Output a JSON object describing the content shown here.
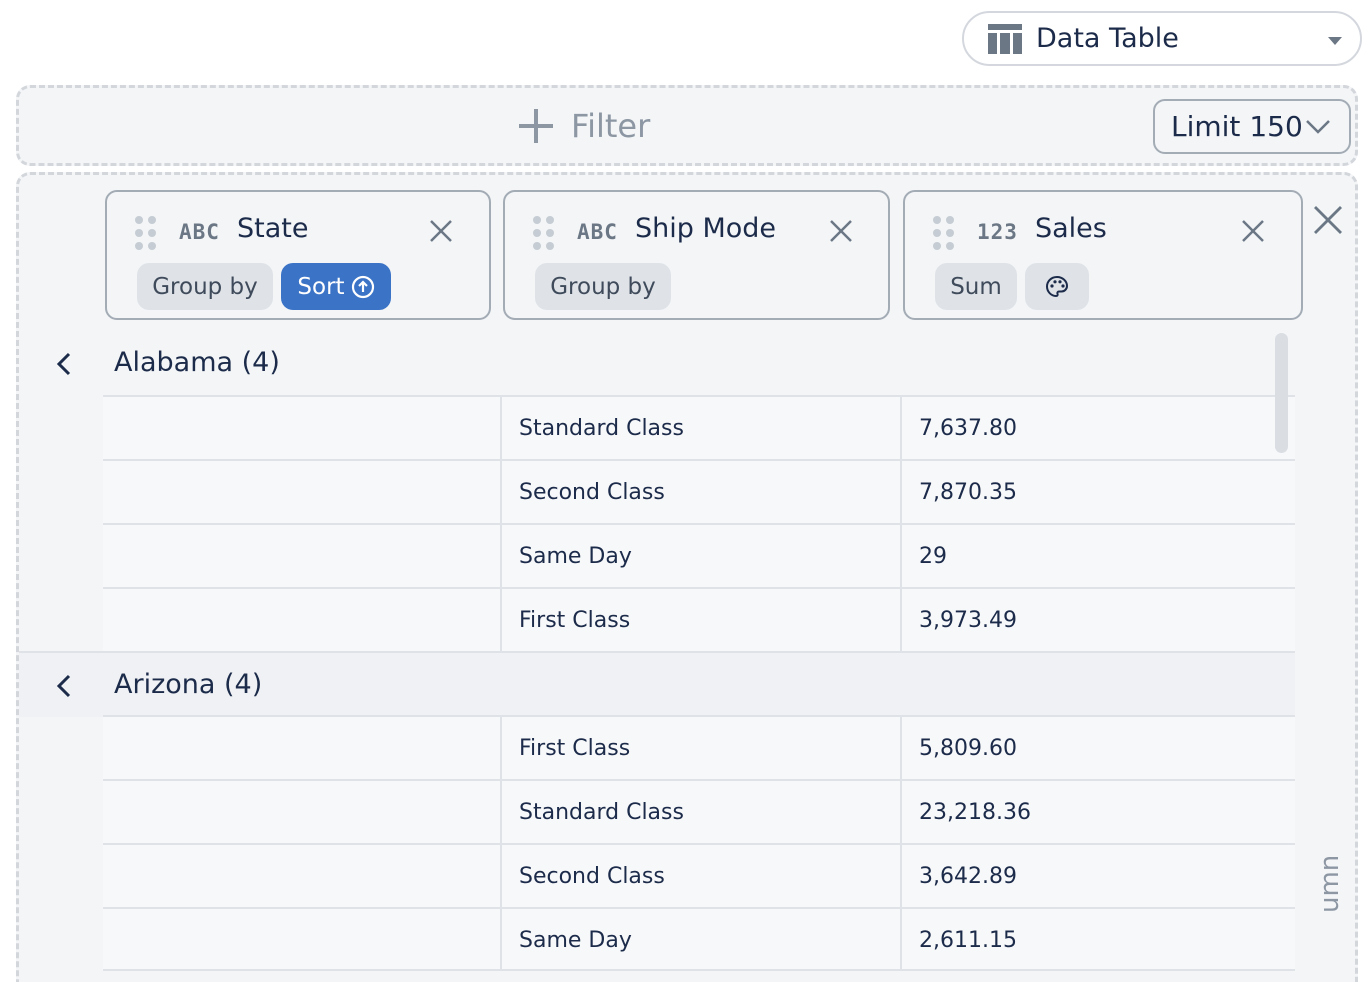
{
  "view_selector": {
    "label": "Data Table",
    "icon": "table-icon"
  },
  "filter_bar": {
    "add_filter_label": "Filter",
    "limit_label": "Limit 150"
  },
  "columns": [
    {
      "type": "ABC",
      "name": "State",
      "pills": [
        "Group by",
        "Sort"
      ]
    },
    {
      "type": "ABC",
      "name": "Ship Mode",
      "pills": [
        "Group by"
      ]
    },
    {
      "type": "123",
      "name": "Sales",
      "pills": [
        "Sum"
      ]
    }
  ],
  "groups": [
    {
      "label": "Alabama (4)",
      "rows": [
        {
          "ship_mode": "Standard Class",
          "sales": "7,637.80"
        },
        {
          "ship_mode": "Second Class",
          "sales": "7,870.35"
        },
        {
          "ship_mode": "Same Day",
          "sales": "29"
        },
        {
          "ship_mode": "First Class",
          "sales": "3,973.49"
        }
      ]
    },
    {
      "label": "Arizona (4)",
      "rows": [
        {
          "ship_mode": "First Class",
          "sales": "5,809.60"
        },
        {
          "ship_mode": "Standard Class",
          "sales": "23,218.36"
        },
        {
          "ship_mode": "Second Class",
          "sales": "3,642.89"
        },
        {
          "ship_mode": "Same Day",
          "sales": "2,611.15"
        }
      ]
    }
  ],
  "side_text": "umn",
  "colors": {
    "accent": "#3b73c6",
    "text": "#1c2b4a",
    "muted": "#8d97a4",
    "panel_bg": "#f3f5f7"
  }
}
